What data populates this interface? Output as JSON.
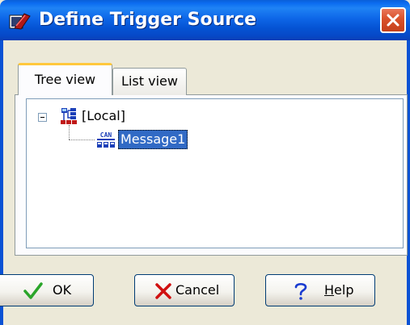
{
  "window": {
    "title": "Define Trigger Source",
    "icon": "trigger-app-icon",
    "close_icon": "close-icon"
  },
  "tabs": [
    {
      "label": "Tree view",
      "selected": true
    },
    {
      "label": "List view",
      "selected": false
    }
  ],
  "tree": {
    "root": {
      "label": "[Local]",
      "icon": "network-node-icon",
      "expanded": true,
      "children": [
        {
          "label": "Message1",
          "icon": "can-message-icon",
          "icon_text": "CAN",
          "selected": true
        }
      ]
    }
  },
  "buttons": {
    "ok": {
      "label": "OK",
      "icon": "checkmark-icon"
    },
    "cancel": {
      "label": "Cancel",
      "icon": "x-icon"
    },
    "help": {
      "label": "Help",
      "icon": "question-icon"
    }
  },
  "colors": {
    "titlebar": "#0a5fd8",
    "selection": "#316ac5",
    "tab_highlight": "#ffc83c",
    "close_button": "#d9512a",
    "ok_icon": "#2aa52a",
    "cancel_icon": "#d01010",
    "help_icon": "#1a3cd0"
  }
}
